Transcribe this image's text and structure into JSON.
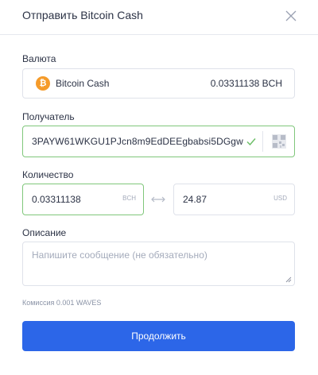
{
  "dialog": {
    "title": "Отправить Bitcoin Cash",
    "close_icon": "close-icon"
  },
  "currency": {
    "label": "Валюта",
    "icon": "bitcoin-icon",
    "icon_glyph": "₿",
    "icon_color": "#f59b2a",
    "name": "Bitcoin Cash",
    "balance": "0.03311138 BCH"
  },
  "recipient": {
    "label": "Получатель",
    "value": "3PAYW61WKGU1PJcn8m9EdDEEgbabsi5DGgw",
    "status_icon": "check-icon",
    "qr_icon": "qr-code-icon"
  },
  "amount": {
    "label": "Количество",
    "crypto_value": "0.03311138",
    "crypto_unit": "BCH",
    "fiat_value": "24.87",
    "fiat_unit": "USD",
    "swap_icon": "swap-arrows-icon"
  },
  "description": {
    "label": "Описание",
    "placeholder": "Напишите сообщение (не обязательно)"
  },
  "fee": "Комиссия 0.001 WAVES",
  "continue_label": "Продолжить",
  "colors": {
    "accent": "#2c66e8",
    "valid_border": "#80c77b",
    "bitcoin": "#f59b2a"
  }
}
